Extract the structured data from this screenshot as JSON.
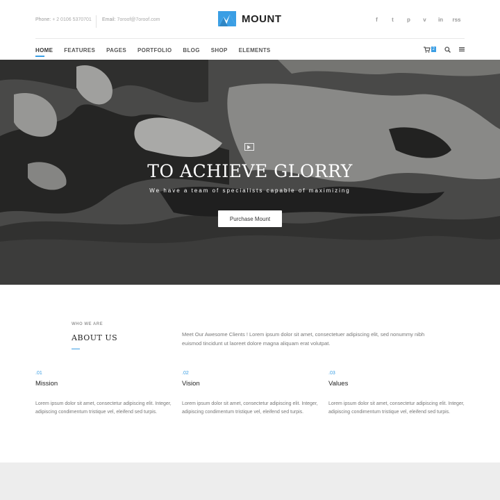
{
  "header": {
    "phone_label": "Phone:",
    "phone_value": "+ 2 0106 5370701",
    "email_label": "Email:",
    "email_value": "7oroof@7oroof.com",
    "logo_text": "MOUNT",
    "social": [
      "f",
      "t",
      "p",
      "v",
      "in",
      "rss"
    ]
  },
  "nav": {
    "items": [
      "HOME",
      "FEATURES",
      "PAGES",
      "PORTFOLIO",
      "BLOG",
      "SHOP",
      "ELEMENTS"
    ],
    "cart_count": "2"
  },
  "hero": {
    "title": "TO ACHIEVE GLORRY",
    "subtitle": "We have a team of specialists capable of maximizing",
    "button": "Purchase Mount"
  },
  "about": {
    "eyebrow": "WHO WE ARE",
    "title": "ABOUT US",
    "text": "Meet Our Awesome Clients ! Lorem ipsum dolor sit amet, consectetuer adipiscing elit, sed nonummy nibh euismod tincidunt ut laoreet dolore magna aliquam erat volutpat."
  },
  "features": [
    {
      "num": ".01",
      "title": "Mission",
      "text": "Lorem ipsum dolor sit amet, consectetur adipiscing elit. Integer, adipiscing condimentum tristique vel, eleifend sed turpis."
    },
    {
      "num": ".02",
      "title": "Vision",
      "text": "Lorem ipsum dolor sit amet, consectetur adipiscing elit. Integer, adipiscing condimentum tristique vel, eleifend sed turpis."
    },
    {
      "num": ".03",
      "title": "Values",
      "text": "Lorem ipsum dolor sit amet, consectetur adipiscing elit. Integer, adipiscing condimentum tristique vel, eleifend sed turpis."
    }
  ],
  "colors": {
    "accent": "#3a9ee4"
  }
}
